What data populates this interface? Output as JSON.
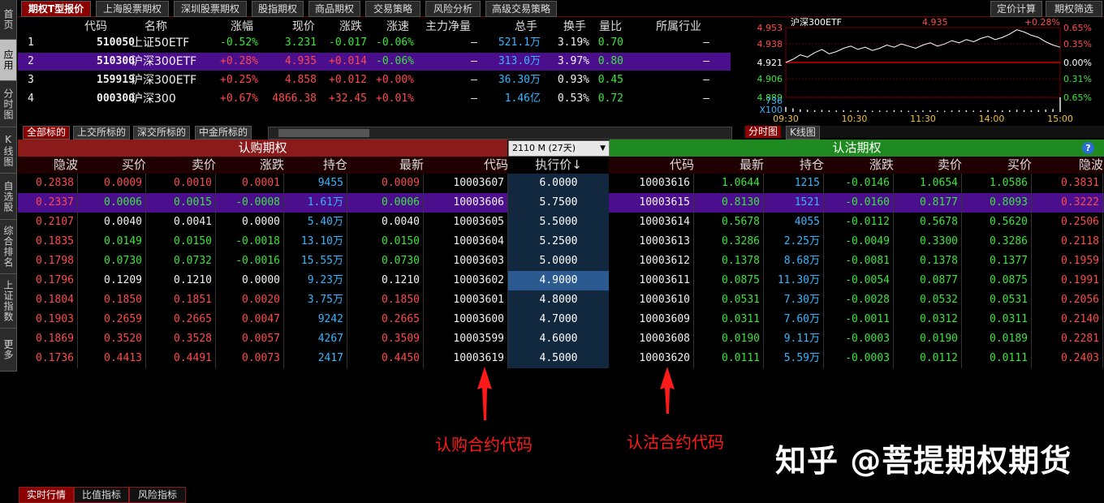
{
  "sidebar": [
    "首页",
    "应用",
    "分时图",
    "K线图",
    "自选股",
    "综合排名",
    "上证指数",
    "更多"
  ],
  "top_tabs": [
    "期权T型报价",
    "上海股票期权",
    "深圳股票期权",
    "股指期权",
    "商品期权",
    "交易策略",
    "风险分析",
    "高级交易策略"
  ],
  "top_right_tabs": [
    "定价计算",
    "期权筛选"
  ],
  "underlying": {
    "headers": [
      "代码",
      "名称",
      "涨幅",
      "现价",
      "涨跌",
      "涨速",
      "主力净量",
      "总手",
      "换手",
      "量比",
      "所属行业"
    ],
    "rows": [
      {
        "idx": "1",
        "code": "510050",
        "name": "上证50ETF",
        "pct": "-0.52%",
        "price": "3.231",
        "chg": "-0.017",
        "speed": "-0.06%",
        "net": "–",
        "vol": "521.1万",
        "turn": "3.19%",
        "ratio": "0.70",
        "ind": "–"
      },
      {
        "idx": "2",
        "code": "510300",
        "name": "沪深300ETF",
        "pct": "+0.28%",
        "price": "4.935",
        "chg": "+0.014",
        "speed": "-0.06%",
        "net": "–",
        "vol": "313.0万",
        "turn": "3.97%",
        "ratio": "0.80",
        "ind": "–"
      },
      {
        "idx": "3",
        "code": "159919",
        "name": "沪深300ETF",
        "pct": "+0.25%",
        "price": "4.858",
        "chg": "+0.012",
        "speed": "+0.00%",
        "net": "–",
        "vol": "36.30万",
        "turn": "0.93%",
        "ratio": "0.45",
        "ind": "–"
      },
      {
        "idx": "4",
        "code": "000300",
        "name": "沪深300",
        "pct": "+0.67%",
        "price": "4866.38",
        "chg": "+32.45",
        "speed": "+0.01%",
        "net": "–",
        "vol": "1.46亿",
        "turn": "0.53%",
        "ratio": "0.72",
        "ind": "–"
      }
    ]
  },
  "exchange_tabs": [
    "全部标的",
    "上交所标的",
    "深交所标的",
    "中金所标的"
  ],
  "mini_chart": {
    "title": "沪深300ETF",
    "price": "4.935",
    "change_pct": "+0.28%",
    "y_left": [
      "4.953",
      "4.938",
      "4.921",
      "4.906",
      "4.889"
    ],
    "y_right": [
      "0.65%",
      "0.35%",
      "0.00%",
      "0.31%",
      "0.65%"
    ],
    "vol_label": "736",
    "vol_unit": "X100",
    "x_labels": [
      "09:30",
      "10:30",
      "11:30",
      "14:00",
      "15:00"
    ],
    "tabs": [
      "分时图",
      "K线图"
    ],
    "line_values": [
      4.921,
      4.924,
      4.928,
      4.926,
      4.93,
      4.933,
      4.929,
      4.931,
      4.934,
      4.936,
      4.933,
      4.935,
      4.932,
      4.934,
      4.937,
      4.935,
      4.938,
      4.936,
      4.934,
      4.937,
      4.939,
      4.936,
      4.938,
      4.941,
      4.939,
      4.942,
      4.94,
      4.943,
      4.945,
      4.942,
      4.944,
      4.947,
      4.951,
      4.949,
      4.946,
      4.944,
      4.94,
      4.937,
      4.935
    ],
    "volumes": [
      0.35,
      0.25,
      0.18,
      0.15,
      0.12,
      0.14,
      0.11,
      0.1,
      0.12,
      0.09,
      0.1,
      0.11,
      0.08,
      0.1,
      0.09,
      0.12,
      0.1,
      0.08,
      0.09,
      0.1,
      0.11,
      0.09,
      0.08,
      0.1,
      0.12,
      0.11,
      0.09,
      0.1,
      0.13,
      0.11,
      0.1,
      0.12,
      0.15,
      0.12,
      0.11,
      0.13,
      0.16,
      0.2,
      1.0
    ]
  },
  "call_header": "认购期权",
  "put_header": "认沽期权",
  "expiry": "2110 M (27天)",
  "option_headers": {
    "call": [
      "隐波",
      "买价",
      "卖价",
      "涨跌",
      "持仓",
      "最新",
      "代码"
    ],
    "strike": "执行价↓",
    "put": [
      "代码",
      "最新",
      "持仓",
      "涨跌",
      "卖价",
      "买价",
      "隐波"
    ]
  },
  "option_rows": [
    {
      "c_iv": "0.2838",
      "c_bid": "0.0009",
      "c_ask": "0.0010",
      "c_chg": "0.0001",
      "c_oi": "9455",
      "c_last": "0.0009",
      "c_code": "10003607",
      "strike": "6.0000",
      "p_code": "10003616",
      "p_last": "1.0644",
      "p_oi": "1215",
      "p_chg": "-0.0146",
      "p_ask": "1.0654",
      "p_bid": "1.0586",
      "p_iv": "0.3831"
    },
    {
      "c_iv": "0.2337",
      "c_bid": "0.0006",
      "c_ask": "0.0015",
      "c_chg": "-0.0008",
      "c_oi": "1.61万",
      "c_last": "0.0006",
      "c_code": "10003606",
      "strike": "5.7500",
      "p_code": "10003615",
      "p_last": "0.8130",
      "p_oi": "1521",
      "p_chg": "-0.0160",
      "p_ask": "0.8177",
      "p_bid": "0.8093",
      "p_iv": "0.3222"
    },
    {
      "c_iv": "0.2107",
      "c_bid": "0.0040",
      "c_ask": "0.0041",
      "c_chg": "0.0000",
      "c_oi": "5.40万",
      "c_last": "0.0040",
      "c_code": "10003605",
      "strike": "5.5000",
      "p_code": "10003614",
      "p_last": "0.5678",
      "p_oi": "4055",
      "p_chg": "-0.0112",
      "p_ask": "0.5678",
      "p_bid": "0.5620",
      "p_iv": "0.2506"
    },
    {
      "c_iv": "0.1835",
      "c_bid": "0.0149",
      "c_ask": "0.0150",
      "c_chg": "-0.0018",
      "c_oi": "13.10万",
      "c_last": "0.0150",
      "c_code": "10003604",
      "strike": "5.2500",
      "p_code": "10003613",
      "p_last": "0.3286",
      "p_oi": "2.25万",
      "p_chg": "-0.0049",
      "p_ask": "0.3300",
      "p_bid": "0.3286",
      "p_iv": "0.2118"
    },
    {
      "c_iv": "0.1798",
      "c_bid": "0.0730",
      "c_ask": "0.0732",
      "c_chg": "-0.0016",
      "c_oi": "15.55万",
      "c_last": "0.0730",
      "c_code": "10003603",
      "strike": "5.0000",
      "p_code": "10003612",
      "p_last": "0.1378",
      "p_oi": "8.68万",
      "p_chg": "-0.0081",
      "p_ask": "0.1378",
      "p_bid": "0.1377",
      "p_iv": "0.1959"
    },
    {
      "c_iv": "0.1796",
      "c_bid": "0.1209",
      "c_ask": "0.1210",
      "c_chg": "0.0000",
      "c_oi": "9.23万",
      "c_last": "0.1210",
      "c_code": "10003602",
      "strike": "4.9000",
      "p_code": "10003611",
      "p_last": "0.0875",
      "p_oi": "11.30万",
      "p_chg": "-0.0054",
      "p_ask": "0.0877",
      "p_bid": "0.0875",
      "p_iv": "0.1991"
    },
    {
      "c_iv": "0.1804",
      "c_bid": "0.1850",
      "c_ask": "0.1851",
      "c_chg": "0.0020",
      "c_oi": "3.75万",
      "c_last": "0.1850",
      "c_code": "10003601",
      "strike": "4.8000",
      "p_code": "10003610",
      "p_last": "0.0531",
      "p_oi": "7.30万",
      "p_chg": "-0.0028",
      "p_ask": "0.0532",
      "p_bid": "0.0531",
      "p_iv": "0.2056"
    },
    {
      "c_iv": "0.1903",
      "c_bid": "0.2659",
      "c_ask": "0.2665",
      "c_chg": "0.0047",
      "c_oi": "9242",
      "c_last": "0.2665",
      "c_code": "10003600",
      "strike": "4.7000",
      "p_code": "10003609",
      "p_last": "0.0311",
      "p_oi": "7.60万",
      "p_chg": "-0.0011",
      "p_ask": "0.0312",
      "p_bid": "0.0311",
      "p_iv": "0.2140"
    },
    {
      "c_iv": "0.1869",
      "c_bid": "0.3520",
      "c_ask": "0.3528",
      "c_chg": "0.0057",
      "c_oi": "4267",
      "c_last": "0.3509",
      "c_code": "10003599",
      "strike": "4.6000",
      "p_code": "10003608",
      "p_last": "0.0190",
      "p_oi": "9.11万",
      "p_chg": "-0.0003",
      "p_ask": "0.0190",
      "p_bid": "0.0189",
      "p_iv": "0.2281"
    },
    {
      "c_iv": "0.1736",
      "c_bid": "0.4413",
      "c_ask": "0.4491",
      "c_chg": "0.0073",
      "c_oi": "2417",
      "c_last": "0.4450",
      "c_code": "10003619",
      "strike": "4.5000",
      "p_code": "10003620",
      "p_last": "0.0111",
      "p_oi": "5.59万",
      "p_chg": "-0.0003",
      "p_ask": "0.0112",
      "p_bid": "0.0111",
      "p_iv": "0.2403"
    }
  ],
  "annotations": {
    "call_code": "认购合约代码",
    "put_code": "认沽合约代码"
  },
  "watermark": "知乎 @菩提期权期货",
  "bottom_tabs": [
    "实时行情",
    "比值指标",
    "风险指标"
  ],
  "colors": {
    "up": "#ff4a4a",
    "down": "#39e639",
    "call_header": "#8b1a1a",
    "put_header": "#1f8a1f",
    "selected_row": "#4b0e8c",
    "strike_bg": "#12283e"
  }
}
